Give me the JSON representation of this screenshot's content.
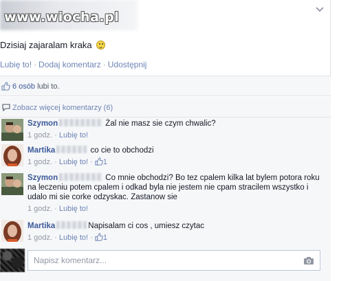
{
  "watermark": "www.wiocha.pl",
  "post": {
    "text": "Dzisiaj zajaralam kraka",
    "emoji": "smile-emoji",
    "actions": [
      "Lubię to!",
      "Dodaj komentarz",
      "Udostępnij"
    ]
  },
  "likes": {
    "count_text": "6 osób",
    "suffix": " lubi to."
  },
  "more_comments": "Zobacz więcej komentarzy (6)",
  "comments": [
    {
      "name": "Szymon",
      "text": "Żal nie masz sie czym chwalic?",
      "time": "1 godz.",
      "like": "Lubię to!",
      "likes": ""
    },
    {
      "name": "Martika",
      "text": "co cie to obchodzi",
      "time": "1 godz.",
      "like": "Lubię to!",
      "likes": "1"
    },
    {
      "name": "Szymon",
      "text": "Co mnie obchodzi? Bo tez cpalem kilka lat bylem potora roku na leczeniu potem cpalem i odkad byla nie jestem nie cpam stracilem wszystko i udalo mi sie corke odzyskac. Zastanow sie",
      "time": "1 godz.",
      "like": "Lubię to!",
      "likes": ""
    },
    {
      "name": "Martika",
      "text": "Napisalam ci cos , umiesz czytac",
      "time": "1 godz.",
      "like": "Lubię to!",
      "likes": "1"
    }
  ],
  "comment_input": {
    "placeholder": "Napisz komentarz..."
  },
  "colors": {
    "link": "#3b5998",
    "muted": "#9197a3",
    "background": "#f6f7f9"
  }
}
